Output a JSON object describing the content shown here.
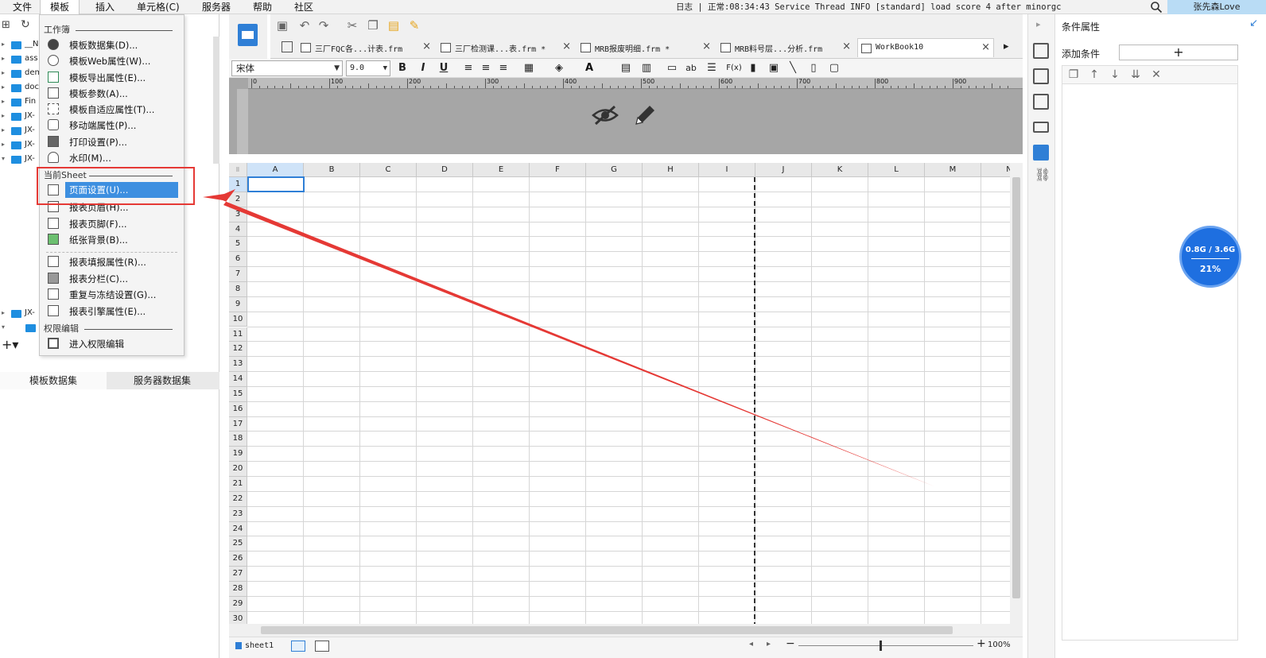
{
  "menubar": {
    "items": [
      "文件",
      "模板",
      "插入",
      "单元格(C)",
      "服务器",
      "帮助",
      "社区"
    ],
    "status": "日志 | 正常:08:34:43 Service Thread INFO [standard] load score 4 after minorgc",
    "user": "张先森Love"
  },
  "tree": {
    "items": [
      "__N",
      "ass",
      "dem",
      "doc",
      "Fin",
      "JX-",
      "JX-",
      "JX-",
      "JX-",
      "JX-"
    ]
  },
  "left_tabs": [
    "模板数据集",
    "服务器数据集"
  ],
  "dropdown": {
    "section_workbook": "工作簿",
    "workbook_items": [
      "模板数据集(D)...",
      "模板Web属性(W)...",
      "模板导出属性(E)...",
      "模板参数(A)...",
      "模板自适应属性(T)...",
      "移动端属性(P)...",
      "打印设置(P)...",
      "水印(M)..."
    ],
    "section_sheet": "当前Sheet",
    "sheet_items": [
      "页面设置(U)...",
      "报表页眉(H)...",
      "报表页脚(F)...",
      "纸张背景(B)..."
    ],
    "more_items": [
      "报表填报属性(R)...",
      "报表分栏(C)...",
      "重复与冻结设置(G)...",
      "报表引擎属性(E)..."
    ],
    "section_perm": "权限编辑",
    "perm_items": [
      "进入权限编辑"
    ]
  },
  "tabs": [
    {
      "label": "三厂FQC各...计表.frm",
      "close": "×"
    },
    {
      "label": "三厂检测课...表.frm *",
      "close": "×"
    },
    {
      "label": "MRB报废明细.frm *",
      "close": "×"
    },
    {
      "label": "MRB料号层...分析.frm",
      "close": "×"
    },
    {
      "label": "WorkBook10",
      "close": "×"
    }
  ],
  "format": {
    "font": "宋体",
    "size": "9.0",
    "buttons": [
      "B",
      "I",
      "U",
      "ab",
      "F(x)"
    ]
  },
  "ruler": {
    "labels": [
      "0",
      "100",
      "200",
      "300",
      "400",
      "500",
      "600",
      "700",
      "800",
      "900"
    ]
  },
  "grid": {
    "columns": [
      "A",
      "B",
      "C",
      "D",
      "E",
      "F",
      "G",
      "H",
      "I",
      "J",
      "K",
      "L",
      "M",
      "N"
    ],
    "rows": [
      "1",
      "2",
      "3",
      "4",
      "5",
      "6",
      "7",
      "8",
      "9",
      "10",
      "11",
      "12",
      "13",
      "14",
      "15",
      "16",
      "17",
      "18",
      "19",
      "20",
      "21",
      "22",
      "23",
      "24",
      "25",
      "26",
      "27",
      "28",
      "29",
      "30"
    ]
  },
  "sheetbar": {
    "sheet": "sheet1",
    "zoom": "100%"
  },
  "right_panel": {
    "title": "条件属性",
    "add_label": "添加条件",
    "add_btn": "+"
  },
  "memory": {
    "usage": "0.8G / 3.6G",
    "percent": "21%"
  },
  "annotation": {
    "color": "#e53935"
  }
}
